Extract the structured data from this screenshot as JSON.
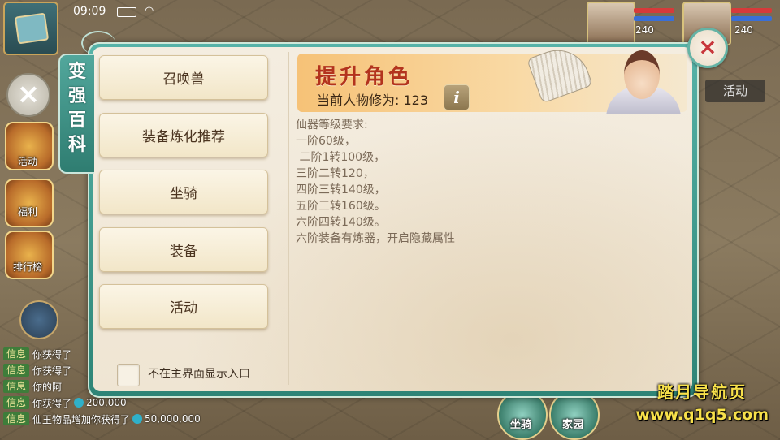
{
  "status_bar": {
    "time": "09:09"
  },
  "background": {
    "side_labels": [
      "活动",
      "福利",
      "排行榜"
    ],
    "activity_button": "活动",
    "player_levels": [
      "240",
      "240"
    ],
    "chat": [
      {
        "tag": "信息",
        "text": "你获得了"
      },
      {
        "tag": "信息",
        "text": "你获得了"
      },
      {
        "tag": "信息",
        "text": "你的阿"
      },
      {
        "tag": "信息",
        "text": "你获得了",
        "amount": "200,000"
      },
      {
        "tag": "信息",
        "text": "仙玉物品增加你获得了",
        "amount": "50,000,000"
      }
    ],
    "bottom_labels": [
      "坐骑",
      "家园"
    ]
  },
  "dialog": {
    "side_tab_title": [
      "变",
      "强",
      "百",
      "科"
    ],
    "menu": [
      {
        "label": "召唤兽"
      },
      {
        "label": "装备炼化推荐"
      },
      {
        "label": "坐骑"
      },
      {
        "label": "装备"
      },
      {
        "label": "活动"
      }
    ],
    "hide_entry_checkbox": {
      "label": "不在主界面显示入口",
      "checked": false
    },
    "header": {
      "title": "提升角色",
      "stat_label": "当前人物修为:",
      "stat_value": "123",
      "info_icon_text": "i"
    },
    "description": [
      "仙器等级要求:",
      "一阶60级，",
      " 二阶1转100级，",
      "三阶二转120，",
      "四阶三转140级，",
      "五阶三转160级。",
      "六阶四转140级。",
      "六阶装备有炼器，开启隐藏属性"
    ],
    "close_label": "×"
  },
  "watermark": {
    "line1": "踏月导航页",
    "line2": "www.q1q5.com"
  },
  "colors": {
    "dialog_frame": "#3f9a8d",
    "title_red": "#b3331d",
    "banner_orange": "#f6c277",
    "button_cream": "#f7eed6",
    "watermark_yellow": "#f7e04a"
  }
}
